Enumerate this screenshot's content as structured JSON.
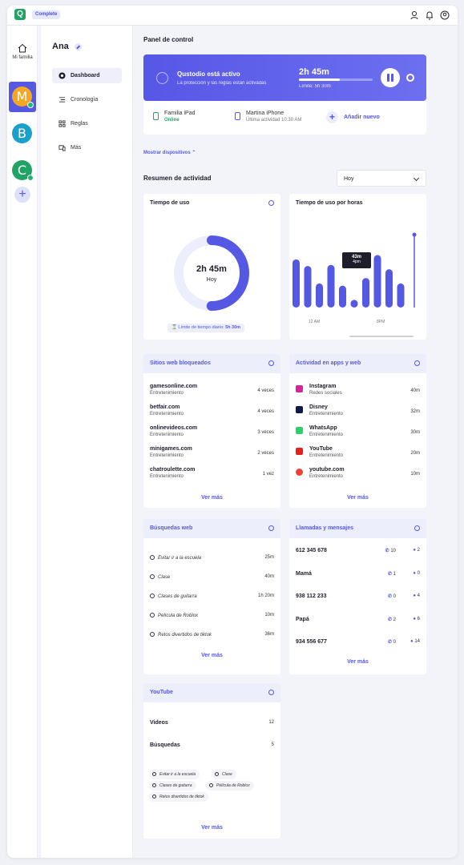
{
  "topbar": {
    "logo": "Q",
    "badge": "Complete",
    "icons": [
      "user-shield-icon",
      "bell-icon",
      "account-icon"
    ]
  },
  "rail": {
    "home_label": "Mi familia",
    "avatars": [
      {
        "letter": "M",
        "color": "#f5a623"
      },
      {
        "letter": "B",
        "color": "#1aa1c9"
      },
      {
        "letter": "C",
        "color": "#21a366"
      }
    ],
    "add": "+"
  },
  "nav": {
    "name": "Ana",
    "items": [
      {
        "label": "Dashboard",
        "icon": "dashboard-icon"
      },
      {
        "label": "Cronología",
        "icon": "timeline-icon"
      },
      {
        "label": "Reglas",
        "icon": "rules-icon"
      },
      {
        "label": "Más",
        "icon": "more-devices-icon"
      }
    ]
  },
  "main": {
    "title": "Panel de control"
  },
  "hero": {
    "title": "Qustodio está activo",
    "subtitle": "La protección y las reglas están activadas",
    "time": "2h 45m",
    "limit": "Límite: 5h 30m",
    "progress": 0.55
  },
  "devices": [
    {
      "name": "Familia iPad",
      "status": "Online",
      "color": "#21a366"
    },
    {
      "name": "Martina iPhone",
      "status": "Última actividad 10:30 AM",
      "color": "#5558e3"
    }
  ],
  "add_new": "Añadir nuevo",
  "show_devices": "Mostrar dispositivos",
  "summary": {
    "title": "Resumen de actividad",
    "range": "Hoy"
  },
  "usage": {
    "title": "Tiempo de uso",
    "value": "2h 45m",
    "sub": "Hoy",
    "limit_text": "Límite de tiempo diario:",
    "limit_value": "5h 30m",
    "fraction": 0.5
  },
  "chart_data": {
    "type": "bar",
    "title": "Tiempo de uso por horas",
    "tick_labels": [
      "12 AM",
      "8PM"
    ],
    "values": [
      44,
      38,
      22,
      39,
      20,
      7,
      27,
      48,
      35,
      22
    ],
    "tooltip_time": "43m",
    "tooltip_hour": "4pm",
    "ylim": [
      0,
      60
    ]
  },
  "blocked": {
    "title": "Sitios web bloqueados",
    "rows": [
      {
        "site": "gamesonline.com",
        "cat": "Entretenimiento",
        "count": "4 veces"
      },
      {
        "site": "betfair.com",
        "cat": "Entretenimiento",
        "count": "4 veces"
      },
      {
        "site": "onlinevideos.com",
        "cat": "Entretenimiento",
        "count": "3 veces"
      },
      {
        "site": "minigames.com",
        "cat": "Entretenimiento",
        "count": "2 veces"
      },
      {
        "site": "chatroulette.com",
        "cat": "Entretenimiento",
        "count": "1 vez"
      }
    ],
    "more": "Ver más"
  },
  "apps": {
    "title": "Actividad en apps y web",
    "rows": [
      {
        "name": "Instagram",
        "cat": "Redes sociales",
        "time": "40m",
        "color": "#d6249f"
      },
      {
        "name": "Disney",
        "cat": "Entretenimiento",
        "time": "32m",
        "color": "#0b1a47"
      },
      {
        "name": "WhatsApp",
        "cat": "Entretenimiento",
        "time": "30m",
        "color": "#25d366"
      },
      {
        "name": "YouTube",
        "cat": "Entretenimiento",
        "time": "20m",
        "color": "#e62117"
      },
      {
        "name": "youtube.com",
        "cat": "Entretenimiento",
        "time": "10m",
        "color": "#ea4335"
      }
    ],
    "more": "Ver más"
  },
  "searches": {
    "title": "Búsquedas web",
    "rows": [
      {
        "q": "Evitar ir a la escuela",
        "t": "25m"
      },
      {
        "q": "Clase",
        "t": "40m"
      },
      {
        "q": "Clases de guitarra",
        "t": "1h 20m"
      },
      {
        "q": "Película de Roblox",
        "t": "10m"
      },
      {
        "q": "Retos divertidos de tiktok",
        "t": "36m"
      }
    ],
    "more": "Ver más"
  },
  "calls": {
    "title": "Llamadas y mensajes",
    "rows": [
      {
        "c": "612 345 678",
        "calls": "10",
        "msgs": "2"
      },
      {
        "c": "Mamá",
        "calls": "1",
        "msgs": "0"
      },
      {
        "c": "938 112 233",
        "calls": "0",
        "msgs": "4"
      },
      {
        "c": "Papá",
        "calls": "2",
        "msgs": "6"
      },
      {
        "c": "934 556 677",
        "calls": "0",
        "msgs": "14"
      }
    ],
    "more": "Ver más"
  },
  "youtube": {
    "title": "YouTube",
    "videos_label": "Videos",
    "videos": "12",
    "searches_label": "Búsquedas",
    "searches": "5",
    "chips": [
      "Evitar ir a la escuela",
      "Clase",
      "Clases de guitarra",
      "Película de Roblox",
      "Retos divertidos de tiktok"
    ],
    "more": "Ver más"
  }
}
